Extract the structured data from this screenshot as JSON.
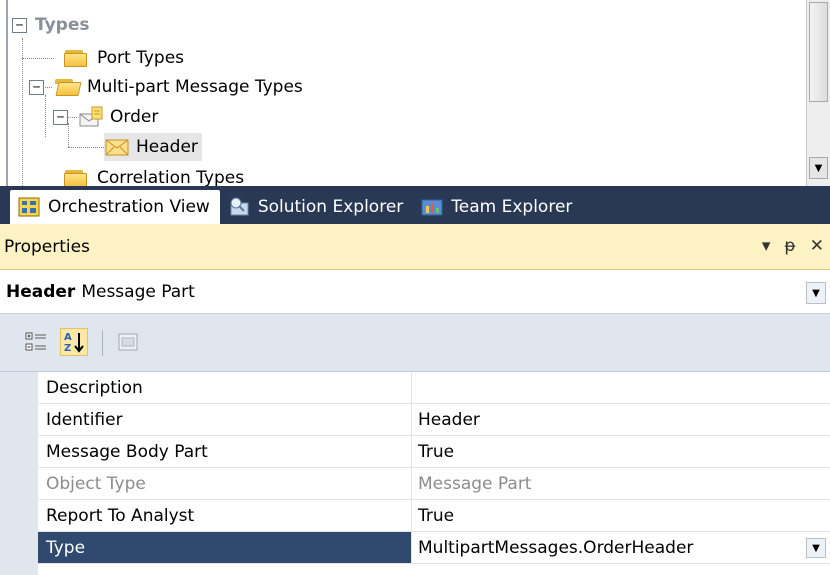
{
  "tree": {
    "root_label": "Types",
    "items": [
      {
        "label": "Port Types"
      },
      {
        "label": "Multi-part Message Types"
      },
      {
        "label": "Order"
      },
      {
        "label": "Header"
      },
      {
        "label": "Correlation Types"
      }
    ],
    "expand_symbol": "−"
  },
  "tabs": [
    {
      "label": "Orchestration View",
      "active": true,
      "icon": "orchestration-view-icon"
    },
    {
      "label": "Solution Explorer",
      "active": false,
      "icon": "solution-explorer-icon"
    },
    {
      "label": "Team Explorer",
      "active": false,
      "icon": "team-explorer-icon"
    }
  ],
  "properties": {
    "title": "Properties",
    "title_buttons": {
      "dropdown": "▾",
      "pin": "ᵽ",
      "close": "✕"
    },
    "object_name": "Header",
    "object_type": "Message Part",
    "rows": [
      {
        "name": "Description",
        "value": ""
      },
      {
        "name": "Identifier",
        "value": "Header"
      },
      {
        "name": "Message Body Part",
        "value": "True"
      },
      {
        "name": "Object Type",
        "value": "Message Part"
      },
      {
        "name": "Report To Analyst",
        "value": "True"
      },
      {
        "name": "Type",
        "value": "MultipartMessages.OrderHeader"
      }
    ]
  },
  "colors": {
    "tab_strip": "#293955",
    "properties_title_bg": "#fdf2c4",
    "selected_row": "#2f4a6e"
  }
}
